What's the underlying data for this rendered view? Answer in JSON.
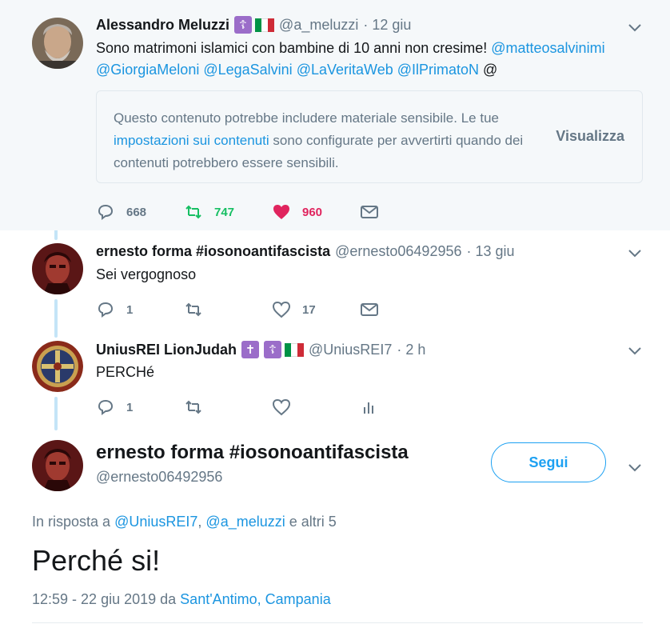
{
  "thread": [
    {
      "name": "Alessandro Meluzzi",
      "handle": "@a_meluzzi",
      "time": "· 12 giu",
      "badges": [
        "☦"
      ],
      "flag": true,
      "text": "Sono matrimoni islamici con bambine di 10 anni non cresime!",
      "mentions_line1": "@matteosalvinimi",
      "mentions_line2": [
        "@GiorgiaMeloni",
        "@LegaSalvini",
        "@LaVeritaWeb",
        "@IlPrimatoN",
        "@"
      ],
      "sensitive": {
        "text_before": "Questo contenuto potrebbe includere materiale sensibile. Le tue",
        "link": "impostazioni sui contenuti",
        "text_after": "sono configurate per avvertirti quando dei contenuti potrebbero essere sensibili.",
        "view": "Visualizza"
      },
      "replies": "668",
      "retweets": "747",
      "likes": "960"
    },
    {
      "name": "ernesto forma #iosonoantifascista",
      "handle": "@ernesto06492956",
      "time": "· 13 giu",
      "text": "Sei vergognoso",
      "replies": "1",
      "retweets": "",
      "likes": "17"
    },
    {
      "name": "UniusREI LionJudah",
      "handle": "@UniusREI7",
      "time": "· 2 h",
      "badges": [
        "✝",
        "☦"
      ],
      "flag": true,
      "text": "PERCHé",
      "replies": "1",
      "retweets": "",
      "likes": ""
    }
  ],
  "main": {
    "name": "ernesto forma #iosonoantifascista",
    "handle": "@ernesto06492956",
    "follow": "Segui",
    "reply_prefix": "In risposta a",
    "reply_user1": "@UniusREI7",
    "reply_sep": ",",
    "reply_user2": "@a_meluzzi",
    "reply_suffix": "e altri 5",
    "text": "Perché si!",
    "datetime": "12:59 - 22 giu 2019 da",
    "location": "Sant'Antimo, Campania"
  },
  "colors": {
    "accent": "#1da1f2",
    "retweet": "#17bf63",
    "like": "#e0245e",
    "muted": "#657786"
  }
}
